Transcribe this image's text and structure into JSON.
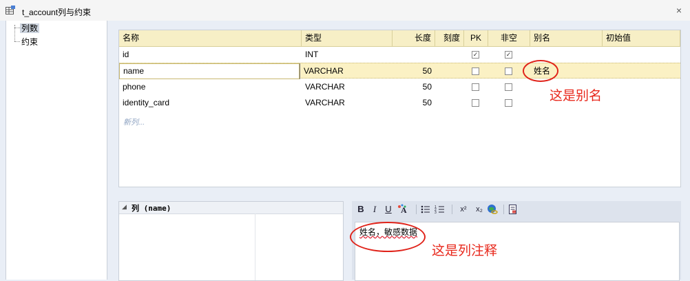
{
  "window": {
    "title": "t_account列与约束",
    "close": "×"
  },
  "tree": {
    "items": [
      {
        "label": "列数",
        "selected": true
      },
      {
        "label": "约束",
        "selected": false
      }
    ]
  },
  "grid": {
    "headers": [
      "名称",
      "类型",
      "长度",
      "刻度",
      "PK",
      "非空",
      "别名",
      "初始值"
    ],
    "rows": [
      {
        "name": "id",
        "type": "INT",
        "length": "",
        "pk": true,
        "notnull": true,
        "alias": ""
      },
      {
        "name": "name",
        "type": "VARCHAR",
        "length": "50",
        "pk": false,
        "notnull": false,
        "alias": "姓名"
      },
      {
        "name": "phone",
        "type": "VARCHAR",
        "length": "50",
        "pk": false,
        "notnull": false,
        "alias": ""
      },
      {
        "name": "identity_card",
        "type": "VARCHAR",
        "length": "50",
        "pk": false,
        "notnull": false,
        "alias": ""
      }
    ],
    "new_column": "新列..."
  },
  "annotations": {
    "alias_note": "这是别名",
    "comment_note": "这是列注释"
  },
  "props": {
    "title": "列 (name)"
  },
  "editor": {
    "toolbar": {
      "bold": "B",
      "italic": "I",
      "underline": "U",
      "superscript": "x²",
      "subscript": "x₂"
    },
    "content": "姓名，敏感数据"
  }
}
